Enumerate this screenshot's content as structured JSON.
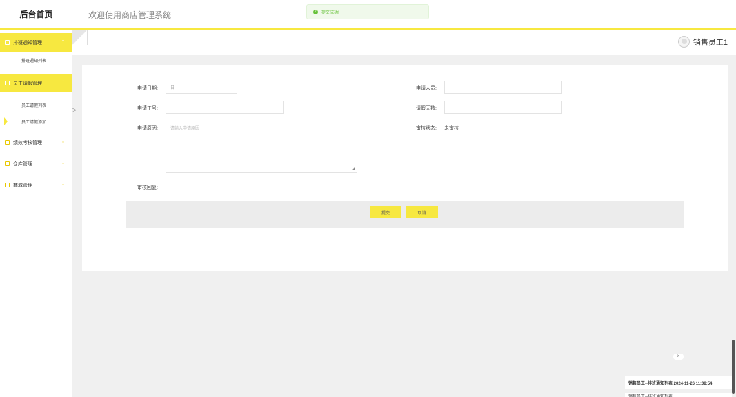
{
  "header": {
    "logo": "后台首页",
    "welcome": "欢迎使用商店管理系统",
    "toast": "提交成功!"
  },
  "sidebar": {
    "groups": [
      {
        "label": "排班通知管理",
        "items": [
          "排班通知列表"
        ]
      },
      {
        "label": "员工请假管理",
        "items": [
          "员工请假列表",
          "员工请假添加"
        ]
      },
      {
        "label": "绩效考核管理"
      },
      {
        "label": "仓库管理"
      },
      {
        "label": "商城管理"
      }
    ]
  },
  "user": {
    "name": "销售员工1"
  },
  "form": {
    "date_label": "申请日期:",
    "date_placeholder": "日",
    "applicant_label": "申请人员:",
    "applicant_value": "",
    "staff_no_label": "申请工号:",
    "staff_no_value": "",
    "days_label": "请假天数:",
    "days_value": "",
    "reason_label": "申请原因:",
    "reason_placeholder": "请输入申请原因",
    "status_label": "审核状态:",
    "status_value": "未审核",
    "reply_label": "审核回复:",
    "submit": "提交",
    "cancel": "取消"
  },
  "notifications": {
    "close": "x",
    "item": "销售员工--排班通知列表 2024-11-26 11:08:54",
    "item2": "销售员工--排班通知列表"
  },
  "colors": {
    "accent": "#f7e840",
    "success": "#67c23a"
  }
}
